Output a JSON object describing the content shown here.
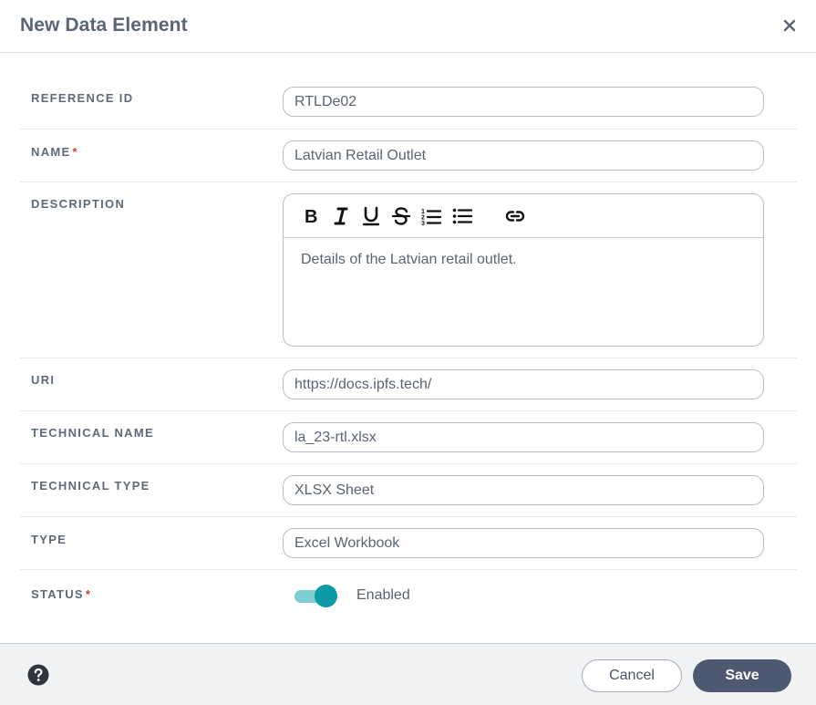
{
  "dialog": {
    "title": "New Data Element"
  },
  "fields": {
    "reference_id": {
      "label": "REFERENCE ID",
      "value": "RTLDe02"
    },
    "name": {
      "label": "NAME",
      "required_marker": "*",
      "value": "Latvian Retail Outlet"
    },
    "description": {
      "label": "DESCRIPTION",
      "value": "Details of the Latvian retail outlet.",
      "toolbar": [
        "bold-icon",
        "italic-icon",
        "underline-icon",
        "strikethrough-icon",
        "ordered-list-icon",
        "bullet-list-icon",
        "link-icon"
      ]
    },
    "uri": {
      "label": "URI",
      "value": "https://docs.ipfs.tech/"
    },
    "technical_name": {
      "label": "TECHNICAL NAME",
      "value": "la_23-rtl.xlsx"
    },
    "technical_type": {
      "label": "TECHNICAL TYPE",
      "value": "XLSX Sheet"
    },
    "type": {
      "label": "TYPE",
      "value": "Excel Workbook"
    },
    "status": {
      "label": "STATUS",
      "required_marker": "*",
      "value": "Enabled",
      "enabled": true
    }
  },
  "footer": {
    "help_icon": "help-circle-icon",
    "cancel_label": "Cancel",
    "save_label": "Save"
  },
  "colors": {
    "accent": "#0c9aa6",
    "toggle_track": "#7ecdd3",
    "primary_button": "#4d5871",
    "required": "#d13c3c"
  }
}
